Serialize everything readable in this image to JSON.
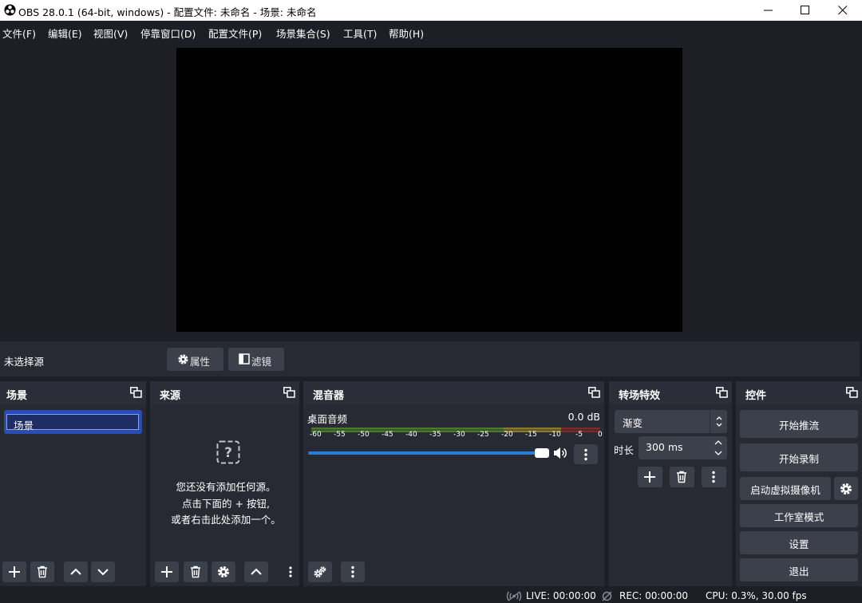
{
  "window": {
    "title": "OBS 28.0.1 (64-bit, windows) - 配置文件: 未命名 - 场景: 未命名"
  },
  "menu": [
    "文件(F)",
    "编辑(E)",
    "视图(V)",
    "停靠窗口(D)",
    "配置文件(P)",
    "场景集合(S)",
    "工具(T)",
    "帮助(H)"
  ],
  "context_bar": {
    "no_source": "未选择源",
    "properties": "属性",
    "filters": "滤镜"
  },
  "docks": {
    "scenes": {
      "title": "场景",
      "items": [
        "场景"
      ]
    },
    "sources": {
      "title": "来源",
      "empty_lines": [
        "您还没有添加任何源。",
        "点击下面的 + 按钮,",
        "或者右击此处添加一个。"
      ]
    },
    "mixer": {
      "title": "混音器",
      "channel": {
        "name": "桌面音频",
        "level": "0.0 dB",
        "volume_fraction": 1.0
      },
      "ticks": [
        "-60",
        "-55",
        "-50",
        "-45",
        "-40",
        "-35",
        "-30",
        "-25",
        "-20",
        "-15",
        "-10",
        "-5",
        "0"
      ]
    },
    "transitions": {
      "title": "转场特效",
      "selected": "渐变",
      "duration_label": "时长",
      "duration_value": "300 ms"
    },
    "controls": {
      "title": "控件",
      "start_streaming": "开始推流",
      "start_recording": "开始录制",
      "start_virtual_cam": "启动虚拟摄像机",
      "studio_mode": "工作室模式",
      "settings": "设置",
      "exit": "退出"
    }
  },
  "status": {
    "live": "LIVE: 00:00:00",
    "rec": "REC: 00:00:00",
    "cpu": "CPU: 0.3%, 30.00 fps"
  },
  "colors": {
    "background": "#1d1f26",
    "panel": "#272a33",
    "button": "#3c404b",
    "selection": "#284cb8",
    "accent": "#2c7bd6"
  }
}
